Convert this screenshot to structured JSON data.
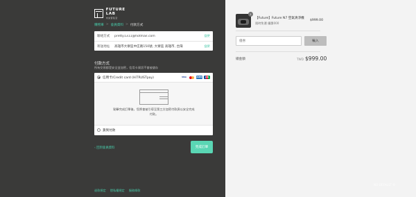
{
  "brand": {
    "name": "FUTURE LAB",
    "sub": "未來實驗室"
  },
  "breadcrumb": {
    "items": [
      "購物車",
      "會員資料",
      "付款方式"
    ],
    "sep": ">"
  },
  "contact": {
    "email_label": "聯絡方式",
    "email_value": "pretty1311@hotmail.com",
    "email_change": "變更",
    "ship_label": "寄送地址",
    "ship_value": "高雄市大寮區中庄路150號, 大寮區 高雄市, 台灣",
    "ship_change": "變更"
  },
  "payment": {
    "title": "付款方式",
    "subtitle": "所有交易都是安全並加密，信用卡資訊不會被儲存",
    "option1": "信用卡/Credit card (HiTRUSTpay)",
    "cards": {
      "visa": "VISA",
      "amex": "AMEX",
      "jcb": "JCB"
    },
    "note": "點擊完成訂單後，您將會被引導至第三方加密付款頁以安全完成付款。",
    "option2": "貨到付款"
  },
  "actions": {
    "back": "‹ 回到會員資料",
    "finish": "完成訂單"
  },
  "footer": {
    "links": [
      "退款規定",
      "隱私權規定",
      "服務條款"
    ]
  },
  "order": {
    "product_name": "【Future】Future N7 空氣清淨機",
    "product_variant": "限時免運 優惠000",
    "qty": "1",
    "price": "$999.00",
    "promo_placeholder": "優惠",
    "promo_button": "輸入",
    "total_label": "總金額",
    "currency": "TWD",
    "total": "$999.00"
  },
  "watermark": "NO DEFAULT ©",
  "colors": {
    "accent": "#48c8a8",
    "button": "#5ad6b4",
    "dark": "#3a3a39"
  }
}
